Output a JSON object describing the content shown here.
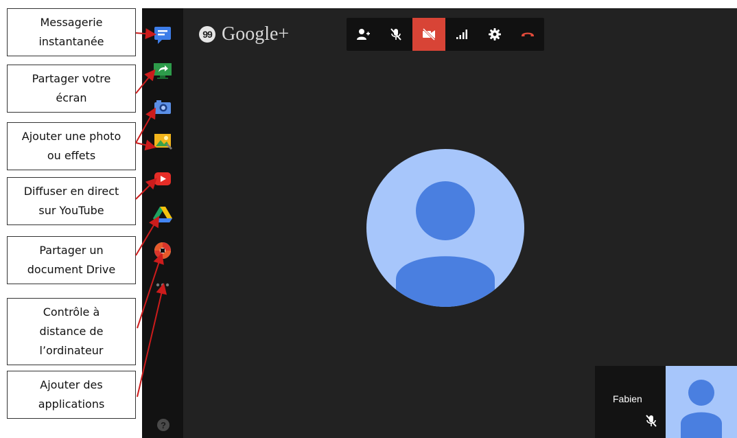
{
  "callouts": [
    "Messagerie\ninstantanée",
    "Partager votre\nécran",
    "Ajouter une photo\nou effets",
    "Diffuser en direct\nsur YouTube",
    "Partager un\ndocument Drive",
    "Contrôle à\ndistance de\nl’ordinateur",
    "Ajouter des\napplications"
  ],
  "app": {
    "brand": "Google+",
    "brand_badge": "99",
    "self_name": "Fabien",
    "help_label": "?"
  },
  "sidebar_icons": [
    "chat-icon",
    "screenshare-icon",
    "camera-icon",
    "photo-effects-icon",
    "youtube-live-icon",
    "drive-icon",
    "remote-desktop-icon",
    "more-apps-icon"
  ],
  "toolbar_icons": [
    "invite-people-icon",
    "mute-mic-icon",
    "video-off-icon",
    "bandwidth-icon",
    "settings-icon",
    "hangup-icon"
  ],
  "colors": {
    "call_bg": "#222222",
    "rail_bg": "#121212",
    "toolbar_bg": "#111111",
    "active_red": "#d84436",
    "avatar_light": "#a7c6fb",
    "avatar_dark": "#4a7fe0",
    "arrow": "#cc1c1c"
  }
}
